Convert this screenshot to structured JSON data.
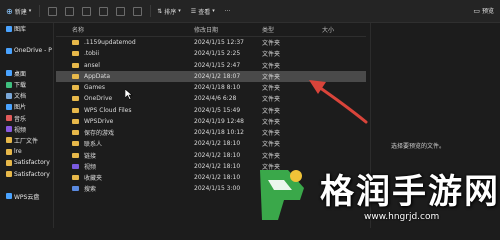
{
  "toolbar": {
    "new_label": "新建",
    "sort_label": "排序",
    "view_label": "查看",
    "more_label": "···",
    "preview_label": "预览"
  },
  "sidebar": {
    "items": [
      {
        "label": "图库",
        "icon": "gallery-icon",
        "color": "#4aa3ff"
      },
      {
        "label": "",
        "icon": "",
        "color": ""
      },
      {
        "label": "OneDrive - Per",
        "icon": "cloud-icon",
        "color": "#4aa3ff"
      },
      {
        "label": "",
        "icon": "",
        "color": ""
      },
      {
        "label": "桌面",
        "icon": "desktop-icon",
        "color": "#4aa3ff"
      },
      {
        "label": "下载",
        "icon": "download-icon",
        "color": "#3fbf7f"
      },
      {
        "label": "文档",
        "icon": "document-icon",
        "color": "#7aa7d8"
      },
      {
        "label": "图片",
        "icon": "picture-icon",
        "color": "#4aa3ff"
      },
      {
        "label": "音乐",
        "icon": "music-icon",
        "color": "#e05a5a"
      },
      {
        "label": "视频",
        "icon": "video-icon",
        "color": "#8a5ae0"
      },
      {
        "label": "工厂文件",
        "icon": "folder-icon",
        "color": "#e7b84a"
      },
      {
        "label": "lre",
        "icon": "folder-icon",
        "color": "#e7b84a"
      },
      {
        "label": "Satisfactory",
        "icon": "folder-icon",
        "color": "#e7b84a"
      },
      {
        "label": "Satisfactory",
        "icon": "folder-icon",
        "color": "#e7b84a"
      },
      {
        "label": "",
        "icon": "",
        "color": ""
      },
      {
        "label": "WPS云盘",
        "icon": "cloud-icon",
        "color": "#4aa3ff"
      }
    ]
  },
  "list": {
    "headers": {
      "name": "名称",
      "date": "修改日期",
      "type": "类型",
      "size": "大小"
    },
    "rows": [
      {
        "name": ".1159updatemod",
        "date": "2024/1/15 12:37",
        "type": "文件夹",
        "folder": "yellow",
        "selected": false
      },
      {
        "name": ".tobii",
        "date": "2024/1/15 2:25",
        "type": "文件夹",
        "folder": "yellow",
        "selected": false
      },
      {
        "name": "ansel",
        "date": "2024/1/15 2:47",
        "type": "文件夹",
        "folder": "yellow",
        "selected": false
      },
      {
        "name": "AppData",
        "date": "2024/1/2 18:07",
        "type": "文件夹",
        "folder": "yellow",
        "selected": true
      },
      {
        "name": "Games",
        "date": "2024/1/18 8:10",
        "type": "文件夹",
        "folder": "yellow",
        "selected": false
      },
      {
        "name": "OneDrive",
        "date": "2024/4/6 6:28",
        "type": "文件夹",
        "folder": "yellow",
        "selected": false
      },
      {
        "name": "WPS Cloud Files",
        "date": "2024/1/5 15:49",
        "type": "文件夹",
        "folder": "yellow",
        "selected": false
      },
      {
        "name": "WPSDrive",
        "date": "2024/1/19 12:48",
        "type": "文件夹",
        "folder": "yellow",
        "selected": false
      },
      {
        "name": "保存的游戏",
        "date": "2024/1/18 10:12",
        "type": "文件夹",
        "folder": "yellow",
        "selected": false
      },
      {
        "name": "联系人",
        "date": "2024/1/2 18:10",
        "type": "文件夹",
        "folder": "yellow",
        "selected": false
      },
      {
        "name": "链接",
        "date": "2024/1/2 18:10",
        "type": "文件夹",
        "folder": "yellow",
        "selected": false
      },
      {
        "name": "视频",
        "date": "2024/1/2 18:10",
        "type": "文件夹",
        "folder": "purple",
        "selected": false
      },
      {
        "name": "收藏夹",
        "date": "2024/1/2 18:10",
        "type": "文件夹",
        "folder": "yellow",
        "selected": false
      },
      {
        "name": "搜索",
        "date": "2024/1/15 3:00",
        "type": "文件夹",
        "folder": "blue",
        "selected": false
      }
    ]
  },
  "preview": {
    "message": "选择要预览的文件。"
  },
  "watermark": {
    "title": "格润手游网",
    "url": "www.hngrjd.com"
  },
  "colors": {
    "accent": "#4aa3ff",
    "folder": "#e7b84a",
    "arrow": "#d9443a",
    "selection": "#4a4a4a"
  }
}
